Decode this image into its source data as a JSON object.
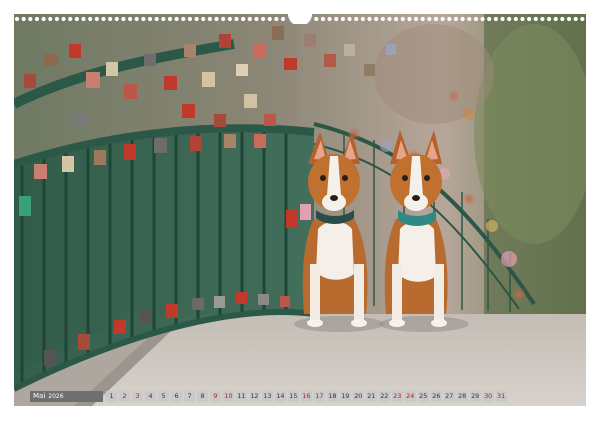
{
  "calendar": {
    "month": "Mai",
    "year": "2026",
    "days": [
      {
        "d": "1",
        "weekend": false
      },
      {
        "d": "2",
        "weekend": true
      },
      {
        "d": "3",
        "weekend": true
      },
      {
        "d": "4",
        "weekend": false
      },
      {
        "d": "5",
        "weekend": false
      },
      {
        "d": "6",
        "weekend": false
      },
      {
        "d": "7",
        "weekend": false
      },
      {
        "d": "8",
        "weekend": false
      },
      {
        "d": "9",
        "weekend": true
      },
      {
        "d": "10",
        "weekend": true
      },
      {
        "d": "11",
        "weekend": false
      },
      {
        "d": "12",
        "weekend": false
      },
      {
        "d": "13",
        "weekend": false
      },
      {
        "d": "14",
        "weekend": false
      },
      {
        "d": "15",
        "weekend": false
      },
      {
        "d": "16",
        "weekend": true
      },
      {
        "d": "17",
        "weekend": true
      },
      {
        "d": "18",
        "weekend": false
      },
      {
        "d": "19",
        "weekend": false
      },
      {
        "d": "20",
        "weekend": false
      },
      {
        "d": "21",
        "weekend": false
      },
      {
        "d": "22",
        "weekend": false
      },
      {
        "d": "23",
        "weekend": true
      },
      {
        "d": "24",
        "weekend": true
      },
      {
        "d": "25",
        "weekend": false
      },
      {
        "d": "26",
        "weekend": false
      },
      {
        "d": "27",
        "weekend": false
      },
      {
        "d": "28",
        "weekend": false
      },
      {
        "d": "29",
        "weekend": false
      },
      {
        "d": "30",
        "weekend": true
      },
      {
        "d": "31",
        "weekend": true
      }
    ],
    "colors": {
      "label_bg": "#6f6f6f",
      "day_bg": "#c9c9c9",
      "weekday_text": "#333333",
      "weekend_text": "#b02020"
    }
  },
  "photo": {
    "subject": "dogs-on-padlock-bridge",
    "icons": [
      "wire-binding-icon",
      "calendar-hanger-icon"
    ]
  }
}
